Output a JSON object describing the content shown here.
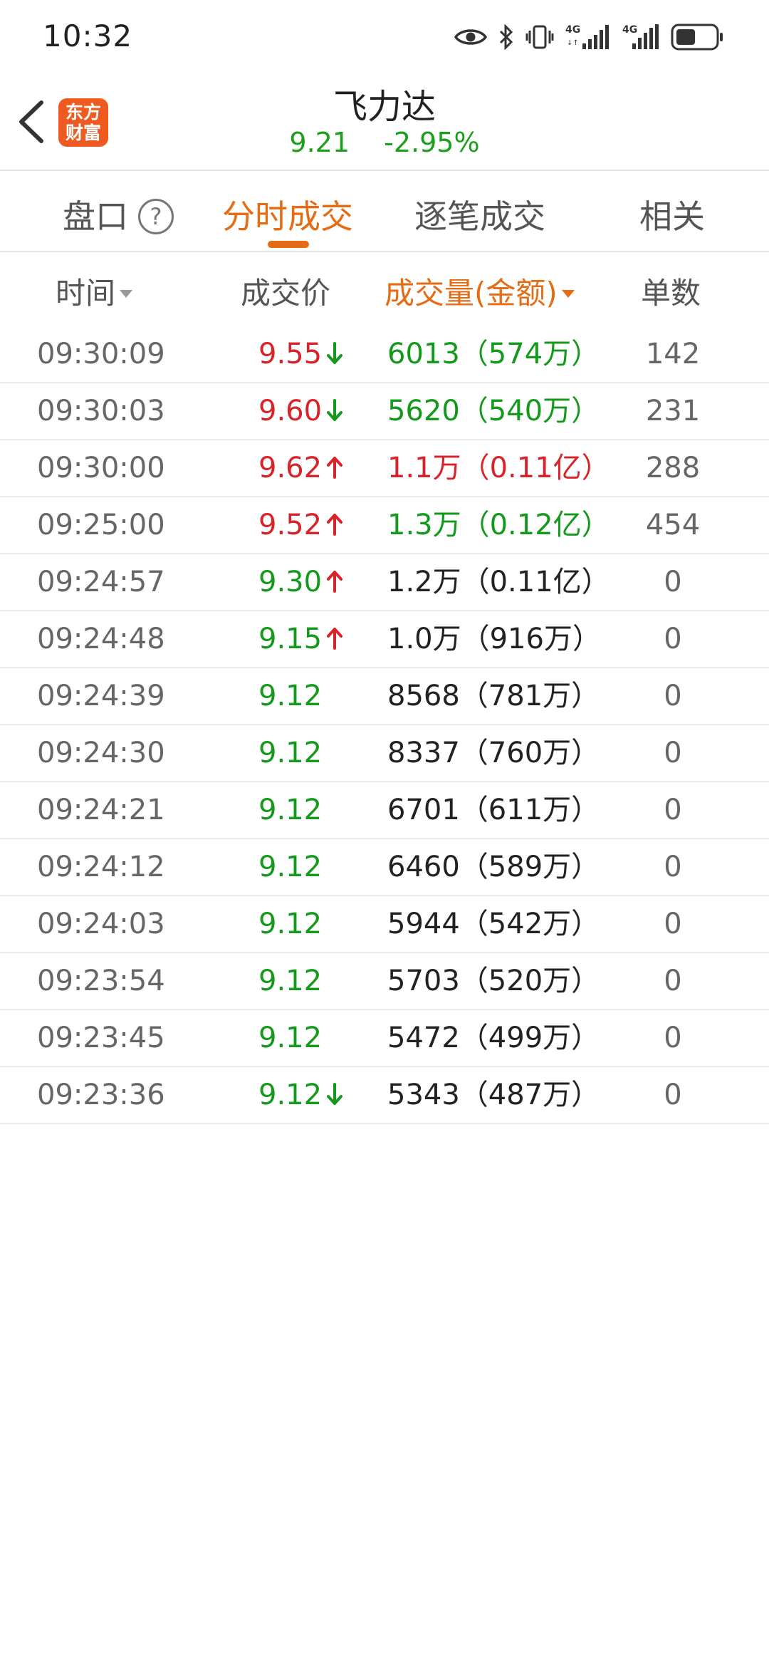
{
  "status_bar": {
    "time": "10:32",
    "icons": [
      "eye-icon",
      "bluetooth-icon",
      "vibrate-icon",
      "signal-4g-icon",
      "signal-4g-icon",
      "battery-icon"
    ]
  },
  "header": {
    "logo_line1": "东方",
    "logo_line2": "财富",
    "stock_name": "飞力达",
    "price": "9.21",
    "change_pct": "-2.95%"
  },
  "tabs": [
    {
      "label": "盘口",
      "active": false
    },
    {
      "label": "分时成交",
      "active": true
    },
    {
      "label": "逐笔成交",
      "active": false
    },
    {
      "label": "相关",
      "active": false
    }
  ],
  "help_glyph": "?",
  "columns": {
    "time": "时间",
    "price": "成交价",
    "volume": "成交量(金额)",
    "count": "单数"
  },
  "colors": {
    "accent": "#e56b14",
    "up": "#d8232a",
    "down": "#13991b",
    "neutral": "#222222"
  },
  "rows": [
    {
      "time": "09:30:09",
      "price": "9.55",
      "price_color": "red",
      "arrow": "down",
      "volume": "6013（574万）",
      "volume_color": "green",
      "count": "142"
    },
    {
      "time": "09:30:03",
      "price": "9.60",
      "price_color": "red",
      "arrow": "down",
      "volume": "5620（540万）",
      "volume_color": "green",
      "count": "231"
    },
    {
      "time": "09:30:00",
      "price": "9.62",
      "price_color": "red",
      "arrow": "up",
      "volume": "1.1万（0.11亿）",
      "volume_color": "red",
      "count": "288"
    },
    {
      "time": "09:25:00",
      "price": "9.52",
      "price_color": "red",
      "arrow": "up",
      "volume": "1.3万（0.12亿）",
      "volume_color": "green",
      "count": "454"
    },
    {
      "time": "09:24:57",
      "price": "9.30",
      "price_color": "green",
      "arrow": "up",
      "volume": "1.2万（0.11亿）",
      "volume_color": "dark",
      "count": "0"
    },
    {
      "time": "09:24:48",
      "price": "9.15",
      "price_color": "green",
      "arrow": "up",
      "volume": "1.0万（916万）",
      "volume_color": "dark",
      "count": "0"
    },
    {
      "time": "09:24:39",
      "price": "9.12",
      "price_color": "green",
      "arrow": "",
      "volume": "8568（781万）",
      "volume_color": "dark",
      "count": "0"
    },
    {
      "time": "09:24:30",
      "price": "9.12",
      "price_color": "green",
      "arrow": "",
      "volume": "8337（760万）",
      "volume_color": "dark",
      "count": "0"
    },
    {
      "time": "09:24:21",
      "price": "9.12",
      "price_color": "green",
      "arrow": "",
      "volume": "6701（611万）",
      "volume_color": "dark",
      "count": "0"
    },
    {
      "time": "09:24:12",
      "price": "9.12",
      "price_color": "green",
      "arrow": "",
      "volume": "6460（589万）",
      "volume_color": "dark",
      "count": "0"
    },
    {
      "time": "09:24:03",
      "price": "9.12",
      "price_color": "green",
      "arrow": "",
      "volume": "5944（542万）",
      "volume_color": "dark",
      "count": "0"
    },
    {
      "time": "09:23:54",
      "price": "9.12",
      "price_color": "green",
      "arrow": "",
      "volume": "5703（520万）",
      "volume_color": "dark",
      "count": "0"
    },
    {
      "time": "09:23:45",
      "price": "9.12",
      "price_color": "green",
      "arrow": "",
      "volume": "5472（499万）",
      "volume_color": "dark",
      "count": "0"
    },
    {
      "time": "09:23:36",
      "price": "9.12",
      "price_color": "green",
      "arrow": "down",
      "volume": "5343（487万）",
      "volume_color": "dark",
      "count": "0"
    }
  ]
}
